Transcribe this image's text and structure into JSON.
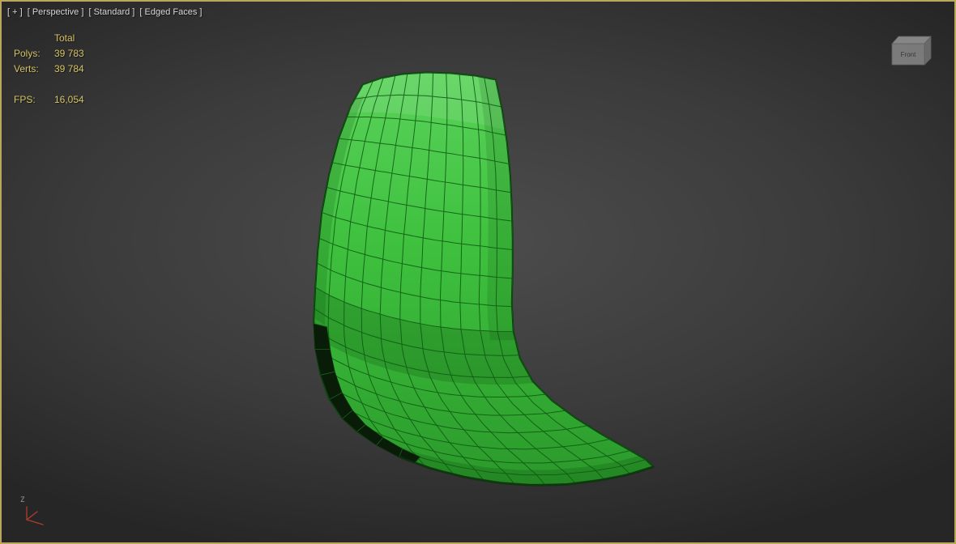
{
  "viewport": {
    "label_segments": [
      {
        "text": "[ + ]"
      },
      {
        "text": "[ Perspective ]"
      },
      {
        "text": "[ Standard ]"
      },
      {
        "text": "[ Edged Faces ]"
      }
    ],
    "stats": {
      "total_header": "Total",
      "rows": [
        {
          "label": "Polys:",
          "value": "39 783"
        },
        {
          "label": "Verts:",
          "value": "39 784"
        }
      ],
      "fps_label": "FPS:",
      "fps_value": "16,054"
    },
    "viewcube": {
      "front_label": "Front"
    },
    "axis_gizmo": {
      "z_label": "Z"
    }
  },
  "colors": {
    "viewport_border": "#b9a85c",
    "label_text": "#d8d8d8",
    "stats_text": "#d5c266",
    "bg_center": "#4d4d4d",
    "bg_edge": "#262626",
    "model_light": "#5ad35a",
    "model_mid": "#3ec03e",
    "model_dark": "#34ad34",
    "model_deep": "#2a962a",
    "wire": "#0f5a12",
    "outline": "#0a3a0c",
    "rim_dark": "#081c08"
  }
}
